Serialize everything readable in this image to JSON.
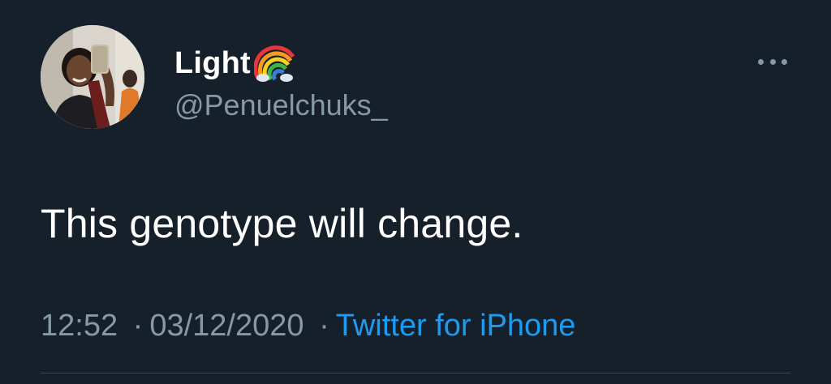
{
  "tweet": {
    "display_name": "Light",
    "handle": "@Penuelchuks_",
    "text": "This genotype will change.",
    "time": "12:52",
    "date": "03/12/2020",
    "separator": "·",
    "source": "Twitter for iPhone"
  },
  "icons": {
    "name_emoji": "rainbow-icon",
    "more": "more-horizontal-icon"
  },
  "colors": {
    "background": "#15202b",
    "secondary_text": "#8899a6",
    "link": "#1d9bf0",
    "divider": "#38444d"
  }
}
